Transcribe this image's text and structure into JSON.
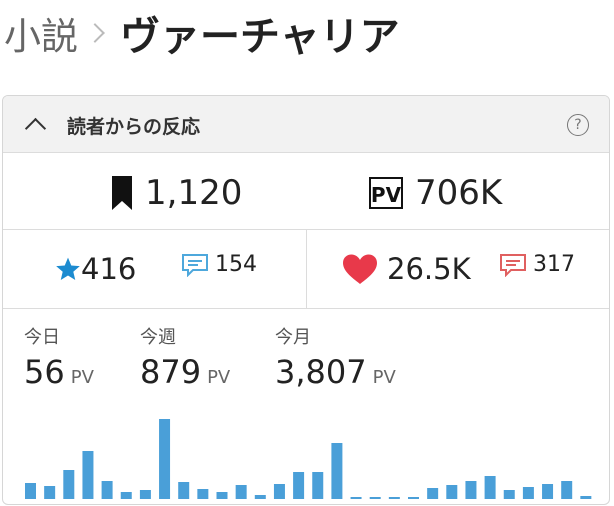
{
  "breadcrumb": {
    "parent": "小説",
    "title": "ヴァーチャリア"
  },
  "panel": {
    "title": "読者からの反応",
    "help": "?"
  },
  "stats": {
    "bookmarks": "1,120",
    "pv_total": "706K",
    "stars": "416",
    "star_reviews": "154",
    "hearts": "26.5K",
    "comments": "317"
  },
  "pv": {
    "today_label": "今日",
    "today": "56",
    "week_label": "今週",
    "week": "879",
    "month_label": "今月",
    "month": "3,807",
    "unit": "PV"
  },
  "chart_data": {
    "type": "bar",
    "title": "",
    "xlabel": "",
    "ylabel": "",
    "color": "#4a9fd8",
    "values": [
      16,
      13,
      29,
      48,
      18,
      7,
      9,
      80,
      17,
      10,
      7,
      14,
      4,
      15,
      27,
      27,
      56,
      2,
      2,
      1,
      2,
      11,
      14,
      18,
      23,
      9,
      12,
      15,
      18,
      3
    ],
    "ylim": [
      0,
      80
    ],
    "grid": false
  },
  "colors": {
    "star": "#1c8bd0",
    "review": "#4ea8dc",
    "heart": "#e8394a",
    "comment": "#e06060"
  }
}
